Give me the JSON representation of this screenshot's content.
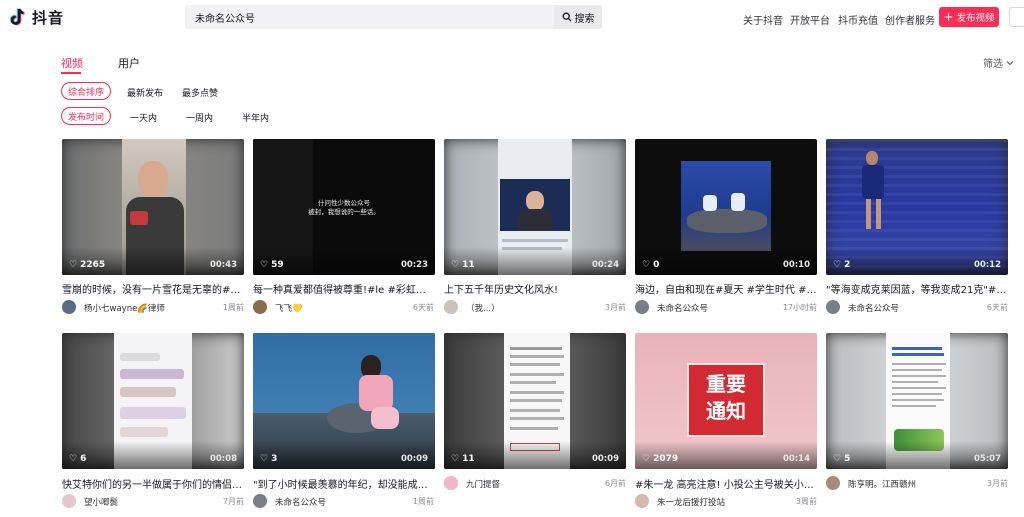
{
  "app": {
    "name": "抖音"
  },
  "search": {
    "value": "未命名公众号",
    "button": "搜索"
  },
  "nav": {
    "about": "关于抖音",
    "open": "开放平台",
    "coins": "抖币充值",
    "creator": "创作者服务",
    "publish": "发布视频"
  },
  "tabs": {
    "video": "视频",
    "user": "用户",
    "filter": "筛选"
  },
  "sort": {
    "active": "综合排序",
    "latest": "最新发布",
    "likes": "最多点赞"
  },
  "time_filter": {
    "active": "发布时间",
    "day": "一天内",
    "week": "一周内",
    "halfyear": "半年内"
  },
  "colors": {
    "accent": "#fe2c55"
  },
  "videos": [
    {
      "likes": "2265",
      "duration": "00:43",
      "title": "雪崩的时候，没有一片雪花是无辜的#彩虹🌈",
      "author": "杨小七wayne🌈律师",
      "time": "1周前"
    },
    {
      "likes": "59",
      "duration": "00:23",
      "title": "每一种真爱都值得被尊重!#le #彩虹男孩",
      "author": "飞飞💛",
      "time": "6天前",
      "overlay": "什问性少数公众号\n被封，我想说的一些话。"
    },
    {
      "likes": "11",
      "duration": "00:24",
      "title": "上下五千年历史文化风水!",
      "author": "（我...）",
      "time": "3月前"
    },
    {
      "likes": "0",
      "duration": "00:10",
      "title": "海边，自由和现在#夏天 #学生时代 #校园 #...",
      "author": "未命名公众号",
      "time": "17小时前"
    },
    {
      "likes": "2",
      "duration": "00:12",
      "title": "\"等海变成克莱因蓝，等我变成21克\"#每一帧...",
      "author": "未命名公众号",
      "time": "6天前"
    },
    {
      "likes": "6",
      "duration": "00:08",
      "title": "快艾特你们的另一半做属于你们的情侣公众号...",
      "author": "望小唧鬓",
      "time": "7月前"
    },
    {
      "likes": "3",
      "duration": "00:09",
      "title": "\"到了小时候最羡慕的年纪，却没能成为最想...",
      "author": "未命名公众号",
      "time": "1周前"
    },
    {
      "likes": "11",
      "duration": "00:09",
      "title": "",
      "author": "九门提督",
      "time": "6月前"
    },
    {
      "likes": "2079",
      "duration": "00:14",
      "title": "#朱一龙 高亮注意! 小投公主号被关小黑屋...",
      "author": "朱一龙后援打投站",
      "time": "3周前",
      "overlay": "重要\n通知"
    },
    {
      "likes": "5",
      "duration": "05:07",
      "title": "",
      "author": "陈亨明。江西赣州",
      "time": "3月前"
    }
  ]
}
